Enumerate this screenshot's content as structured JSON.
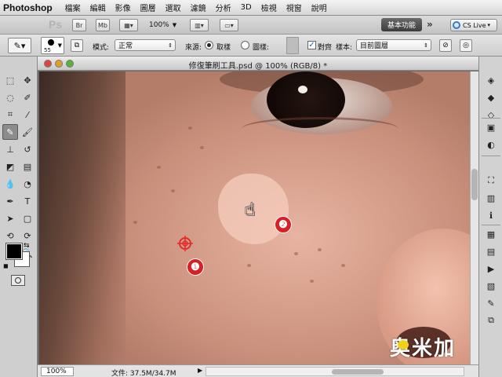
{
  "menu": {
    "app": "Photoshop",
    "items": [
      "檔案",
      "編輯",
      "影像",
      "圖層",
      "選取",
      "濾鏡",
      "分析",
      "3D",
      "檢視",
      "視窗",
      "說明"
    ]
  },
  "appbar": {
    "logo": "Ps",
    "br": "Br",
    "mb": "Mb",
    "zoom": "100%",
    "workspace": "基本功能",
    "more": "»",
    "cs_live": "CS Live"
  },
  "options": {
    "brush_size": "55",
    "mode_label": "模式:",
    "mode_value": "正常",
    "source_label": "來源:",
    "source_sampled": "取樣",
    "source_pattern": "圖樣:",
    "aligned_label": "對齊",
    "sample_label": "樣本:",
    "sample_value": "目前圖層"
  },
  "document": {
    "title": "修復筆刷工具.psd @ 100% (RGB/8) *",
    "zoom": "100%",
    "file_info": "文件: 37.5M/34.7M",
    "markers": [
      "❶",
      "❷"
    ],
    "watermark": "奥米加"
  },
  "colors": {
    "foreground": "#000000",
    "background": "#ffffff",
    "marker_red": "#d81f26",
    "workspace_bg": "#4a4a4a"
  },
  "icons": {
    "toolbox": [
      "marquee-icon",
      "move-icon",
      "lasso-icon",
      "quick-select-icon",
      "crop-icon",
      "eyedropper-icon",
      "healing-brush-icon",
      "brush-icon",
      "clone-stamp-icon",
      "history-brush-icon",
      "eraser-icon",
      "gradient-icon",
      "blur-icon",
      "dodge-icon",
      "pen-icon",
      "type-icon",
      "path-select-icon",
      "shape-icon",
      "3d-rotate-icon",
      "3d-orbit-icon",
      "hand-icon",
      "zoom-icon"
    ],
    "dock": [
      "layers-panel-icon",
      "channels-panel-icon",
      "paths-panel-icon",
      "adjustments-panel-icon",
      "masks-panel-icon",
      "navigator-panel-icon",
      "histogram-panel-icon",
      "info-panel-icon",
      "swatches-panel-icon",
      "styles-panel-icon",
      "actions-panel-icon",
      "history-panel-icon",
      "brushes-panel-icon",
      "clone-source-panel-icon"
    ]
  }
}
